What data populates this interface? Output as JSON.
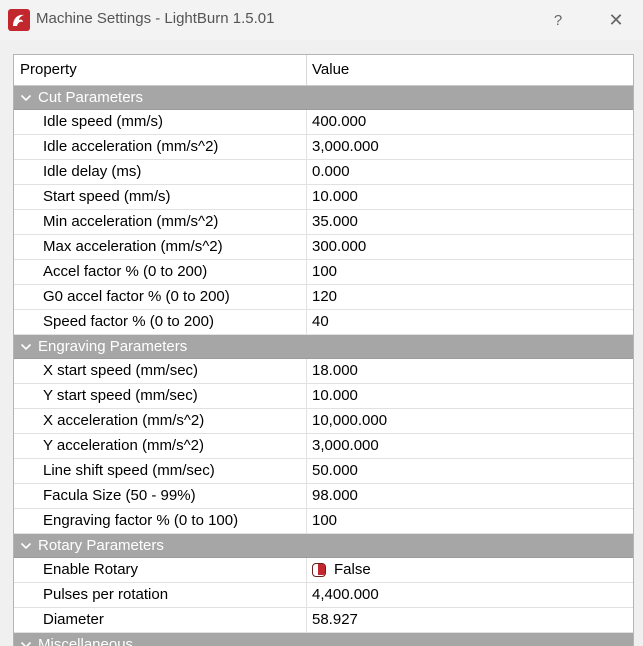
{
  "window": {
    "title": "Machine Settings - LightBurn 1.5.01",
    "help_label": "?",
    "close_label": "✕",
    "accent": "#c1272d"
  },
  "table": {
    "columns": [
      "Property",
      "Value"
    ],
    "groups": [
      {
        "label": "Cut Parameters",
        "rows": [
          {
            "property": "Idle speed (mm/s)",
            "value": "400.000"
          },
          {
            "property": "Idle acceleration (mm/s^2)",
            "value": "3,000.000"
          },
          {
            "property": "Idle delay (ms)",
            "value": "0.000"
          },
          {
            "property": "Start speed (mm/s)",
            "value": "10.000"
          },
          {
            "property": "Min acceleration (mm/s^2)",
            "value": "35.000"
          },
          {
            "property": "Max acceleration (mm/s^2)",
            "value": "300.000"
          },
          {
            "property": "Accel factor % (0 to 200)",
            "value": "100"
          },
          {
            "property": "G0 accel factor % (0 to 200)",
            "value": "120"
          },
          {
            "property": "Speed factor % (0 to 200)",
            "value": "40"
          }
        ]
      },
      {
        "label": "Engraving Parameters",
        "rows": [
          {
            "property": "X start speed (mm/sec)",
            "value": "18.000"
          },
          {
            "property": "Y start speed (mm/sec)",
            "value": "10.000"
          },
          {
            "property": "X acceleration (mm/s^2)",
            "value": "10,000.000"
          },
          {
            "property": "Y acceleration (mm/s^2)",
            "value": "3,000.000"
          },
          {
            "property": "Line shift speed (mm/sec)",
            "value": "50.000"
          },
          {
            "property": "Facula Size (50 - 99%)",
            "value": "98.000"
          },
          {
            "property": "Engraving factor % (0 to 100)",
            "value": "100"
          }
        ]
      },
      {
        "label": "Rotary Parameters",
        "rows": [
          {
            "property": "Enable Rotary",
            "value": "False",
            "toggle": true
          },
          {
            "property": "Pulses per rotation",
            "value": "4,400.000"
          },
          {
            "property": "Diameter",
            "value": "58.927"
          }
        ]
      },
      {
        "label": "Miscellaneous",
        "rows": []
      }
    ]
  }
}
